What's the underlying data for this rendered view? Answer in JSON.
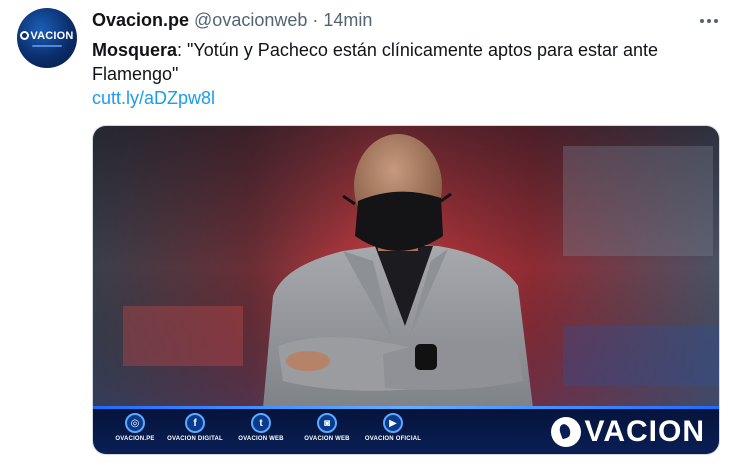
{
  "tweet": {
    "display_name": "Ovacion.pe",
    "handle": "@ovacionweb",
    "separator": "·",
    "time": "14min",
    "text_bold": "Mosquera",
    "text_rest": ": \"Yotún y Pacheco están clínicamente aptos para estar ante Flamengo\"",
    "link": "cutt.ly/aDZpw8l",
    "avatar_logo_text": "VACION"
  },
  "media": {
    "socials": [
      {
        "icon": "globe-icon",
        "glyph": "◎",
        "label": "OVACION.PE"
      },
      {
        "icon": "facebook-icon",
        "glyph": "f",
        "label": "OVACION DIGITAL"
      },
      {
        "icon": "twitter-icon",
        "glyph": "t",
        "label": "OVACION WEB"
      },
      {
        "icon": "instagram-icon",
        "glyph": "◙",
        "label": "OVACION WEB"
      },
      {
        "icon": "youtube-icon",
        "glyph": "▶",
        "label": "OVACION OFICIAL"
      }
    ],
    "brand_text": "VACION"
  },
  "colors": {
    "link": "#1d9bf0",
    "muted": "#536471",
    "banner": "#0a1f55"
  }
}
